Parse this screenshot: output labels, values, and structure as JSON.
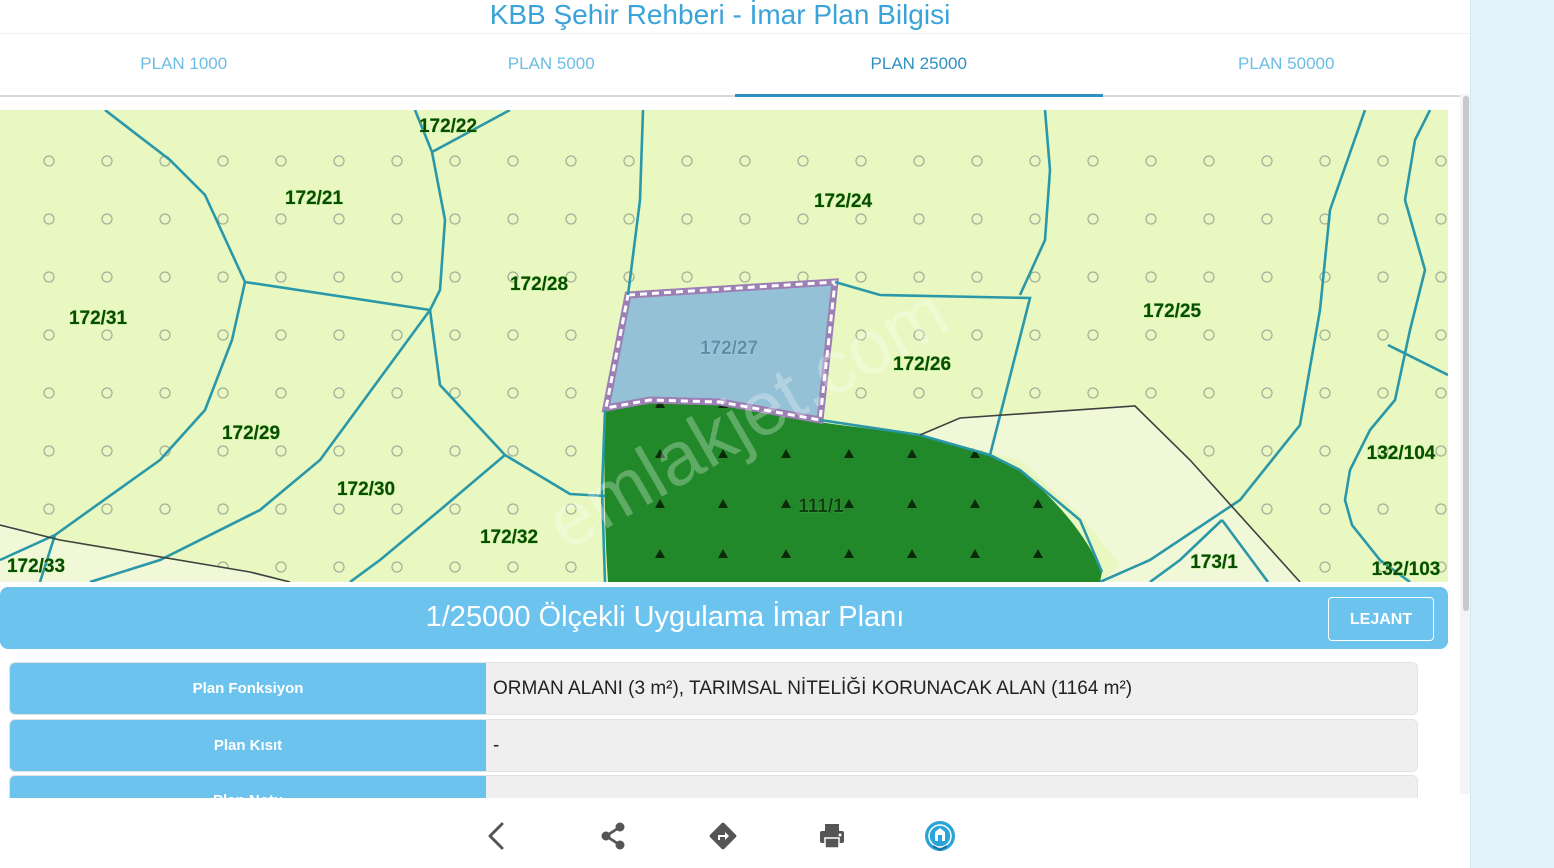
{
  "header": {
    "title": "KBB Şehir Rehberi - İmar Plan Bilgisi"
  },
  "tabs": [
    {
      "label": "PLAN 1000",
      "active": false
    },
    {
      "label": "PLAN 5000",
      "active": false
    },
    {
      "label": "PLAN 25000",
      "active": true
    },
    {
      "label": "PLAN 50000",
      "active": false
    }
  ],
  "map": {
    "parcels": [
      "172/22",
      "172/21",
      "172/24",
      "172/31",
      "172/28",
      "172/27",
      "172/25",
      "172/26",
      "172/29",
      "132/104",
      "172/30",
      "111/1",
      "172/32",
      "172/33",
      "173/1",
      "132/103"
    ],
    "watermark": "emlakjet.com",
    "colors": {
      "agri": "#e8f8c0",
      "forest": "#22892a",
      "selected": "#95c1d6",
      "boundary": "#2a98a8",
      "outline": "#9b7fb5"
    }
  },
  "plan": {
    "title": "1/25000 Ölçekli Uygulama İmar Planı",
    "lejant_label": "LEJANT",
    "rows": [
      {
        "key": "Plan Fonksiyon",
        "value": "ORMAN ALANI (3 m²), TARIMSAL NİTELİĞİ KORUNACAK ALAN (1164 m²)"
      },
      {
        "key": "Plan Kısıt",
        "value": "-"
      },
      {
        "key": "Plan Notu",
        "value": ""
      }
    ]
  },
  "bottom_nav": [
    "back-icon",
    "share-icon",
    "directions-icon",
    "print-icon",
    "city-logo-icon"
  ]
}
